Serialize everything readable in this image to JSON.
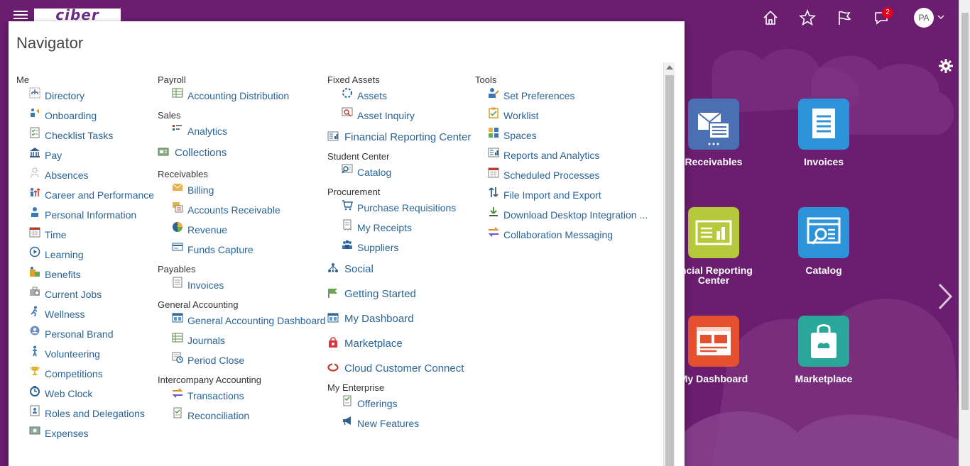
{
  "header": {
    "logo_text": "ciber",
    "notification_count": "2",
    "user_initials": "PA"
  },
  "navigator": {
    "title": "Navigator",
    "columns": [
      {
        "groups": [
          {
            "title": "Me",
            "items": [
              "Directory",
              "Onboarding",
              "Checklist Tasks",
              "Pay",
              "Absences",
              "Career and Performance",
              "Personal Information",
              "Time",
              "Learning",
              "Benefits",
              "Current Jobs",
              "Wellness",
              "Personal Brand",
              "Volunteering",
              "Competitions",
              "Web Clock",
              "Roles and Delegations",
              "Expenses"
            ]
          }
        ]
      },
      {
        "payroll": {
          "title": "Payroll",
          "items": [
            "Accounting Distribution"
          ]
        },
        "sales": {
          "title": "Sales",
          "items": [
            "Analytics"
          ]
        },
        "collections": "Collections",
        "receivables": {
          "title": "Receivables",
          "items": [
            "Billing",
            "Accounts Receivable",
            "Revenue",
            "Funds Capture"
          ]
        },
        "payables": {
          "title": "Payables",
          "items": [
            "Invoices"
          ]
        },
        "general_accounting": {
          "title": "General Accounting",
          "items": [
            "General Accounting Dashboard",
            "Journals",
            "Period Close"
          ]
        },
        "intercompany": {
          "title": "Intercompany Accounting",
          "items": [
            "Transactions",
            "Reconciliation"
          ]
        }
      },
      {
        "fixed_assets": {
          "title": "Fixed Assets",
          "items": [
            "Assets",
            "Asset Inquiry"
          ]
        },
        "financial_reporting_center": "Financial Reporting Center",
        "student_center": {
          "title": "Student Center",
          "items": [
            "Catalog"
          ]
        },
        "procurement": {
          "title": "Procurement",
          "items": [
            "Purchase Requisitions",
            "My Receipts",
            "Suppliers"
          ]
        },
        "standalone": [
          "Social",
          "Getting Started",
          "My Dashboard",
          "Marketplace",
          "Cloud Customer Connect"
        ],
        "my_enterprise": {
          "title": "My Enterprise",
          "items": [
            "Offerings",
            "New Features"
          ]
        }
      },
      {
        "tools": {
          "title": "Tools",
          "items": [
            "Set Preferences",
            "Worklist",
            "Spaces",
            "Reports and Analytics",
            "Scheduled Processes",
            "File Import and Export",
            "Download Desktop Integration ...",
            "Collaboration Messaging"
          ]
        }
      }
    ]
  },
  "springboard": {
    "tiles": [
      {
        "label": "Receivables",
        "color": "#4a6fb3"
      },
      {
        "label": "Invoices",
        "color": "#2d93d8"
      },
      {
        "label": "ancial Reporting Center",
        "color": "#b5c93a"
      },
      {
        "label": "Catalog",
        "color": "#2d93d8"
      },
      {
        "label": "My Dashboard",
        "color": "#e5512f"
      },
      {
        "label": "Marketplace",
        "color": "#2aa69a"
      }
    ]
  }
}
